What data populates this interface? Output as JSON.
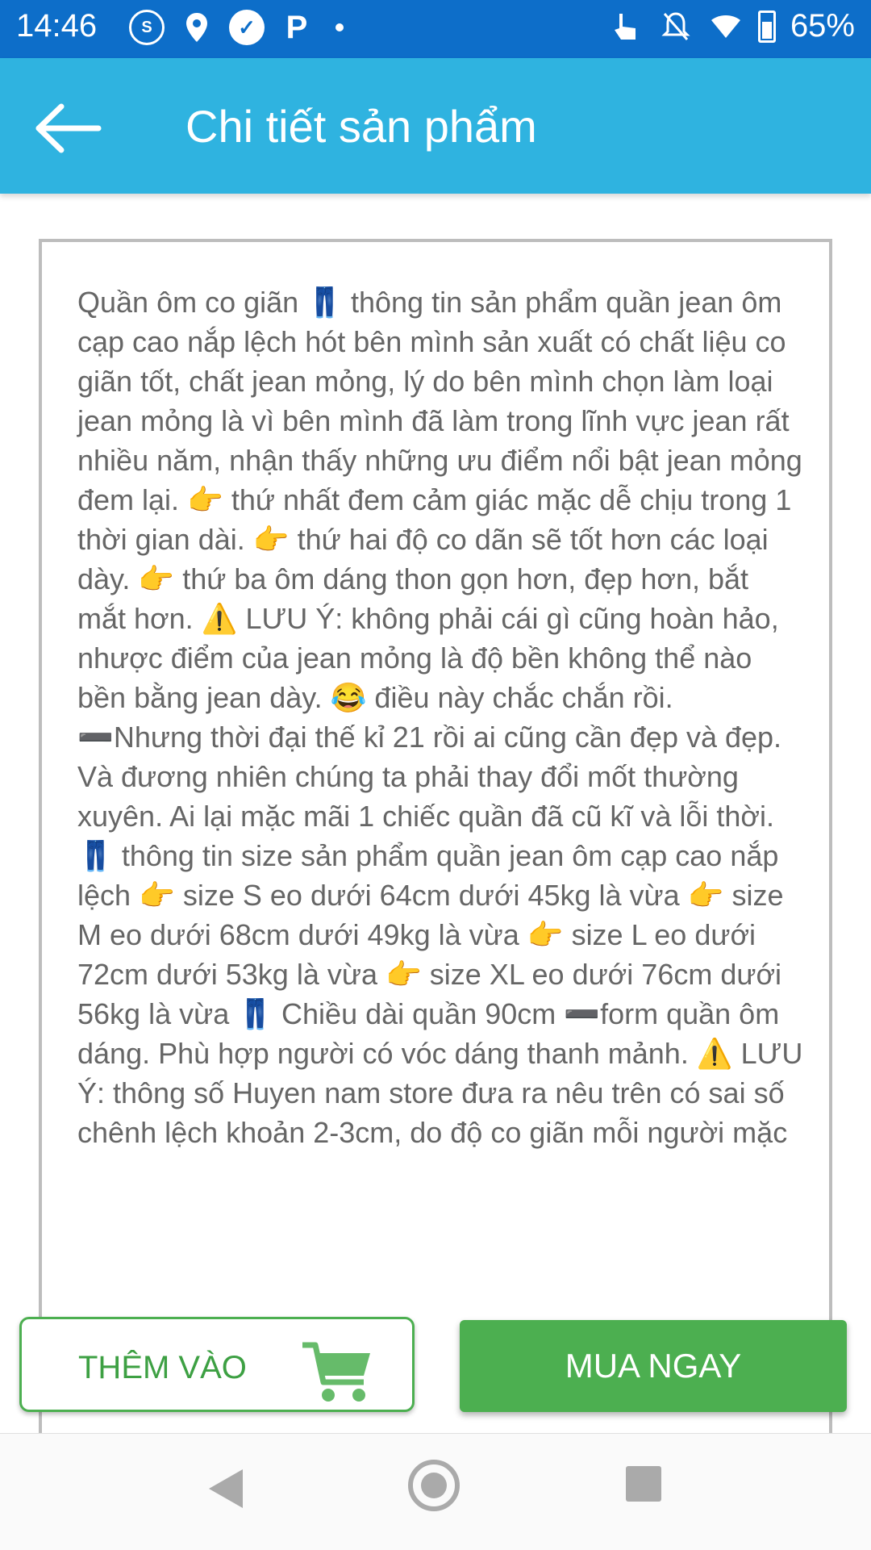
{
  "status_bar": {
    "time": "14:46",
    "battery": "65%",
    "icons_left": [
      "sim-icon",
      "location-icon",
      "check-icon",
      "parking-icon",
      "dot-icon"
    ],
    "icons_right": [
      "touch-icon",
      "mute-icon",
      "wifi-icon",
      "battery-icon"
    ]
  },
  "app_bar": {
    "title": "Chi tiết sản phẩm",
    "back_icon": "arrow-left-icon"
  },
  "description": {
    "text": "Quần ôm co giãn 👖 thông tin sản phẩm quần jean ôm cạp cao nắp lệch hót bên mình sản xuất có chất liệu co giãn tốt, chất jean mỏng, lý do bên mình chọn làm loại jean mỏng là vì bên mình đã làm trong lĩnh vực jean rất nhiều năm, nhận thấy những ưu điểm nổi bật jean mỏng đem lại. 👉 thứ nhất đem cảm giác mặc dễ chịu trong 1 thời gian dài. 👉 thứ hai độ co dãn sẽ tốt hơn các loại dày. 👉 thứ ba ôm dáng thon gọn hơn, đẹp hơn, bắt mắt hơn. ⚠️ LƯU Ý: không phải cái gì cũng hoàn hảo, nhược điểm của jean mỏng là độ bền không thể nào bền bằng jean dày. 😂 điều này chắc chắn rồi. ➖Nhưng thời đại thế kỉ 21 rồi ai cũng cần đẹp và đẹp. Và đương nhiên chúng ta phải thay đổi mốt thường xuyên. Ai lại mặc mãi 1 chiếc quần đã cũ kĩ và lỗi thời. 👖 thông tin size sản phẩm quần jean ôm cạp cao nắp lệch 👉 size S eo dưới 64cm dưới 45kg là vừa 👉 size M eo dưới 68cm dưới 49kg là vừa 👉 size L eo dưới 72cm dưới 53kg là vừa 👉 size XL eo dưới 76cm dưới 56kg là vừa 👖 Chiều dài quần 90cm ➖form quần ôm dáng. Phù hợp người có vóc dáng thanh mảnh. ⚠️ LƯU Ý: thông số Huyen nam store đưa ra nêu trên có sai số chênh lệch khoản 2-3cm, do độ co giãn mỗi người mặc"
  },
  "actions": {
    "add_label": "THÊM VÀO",
    "buy_label": "MUA NGAY"
  },
  "colors": {
    "status_bar": "#0d6ec9",
    "app_bar": "#2fb3e0",
    "accent_green": "#4caf50",
    "text_gray": "#666666"
  }
}
